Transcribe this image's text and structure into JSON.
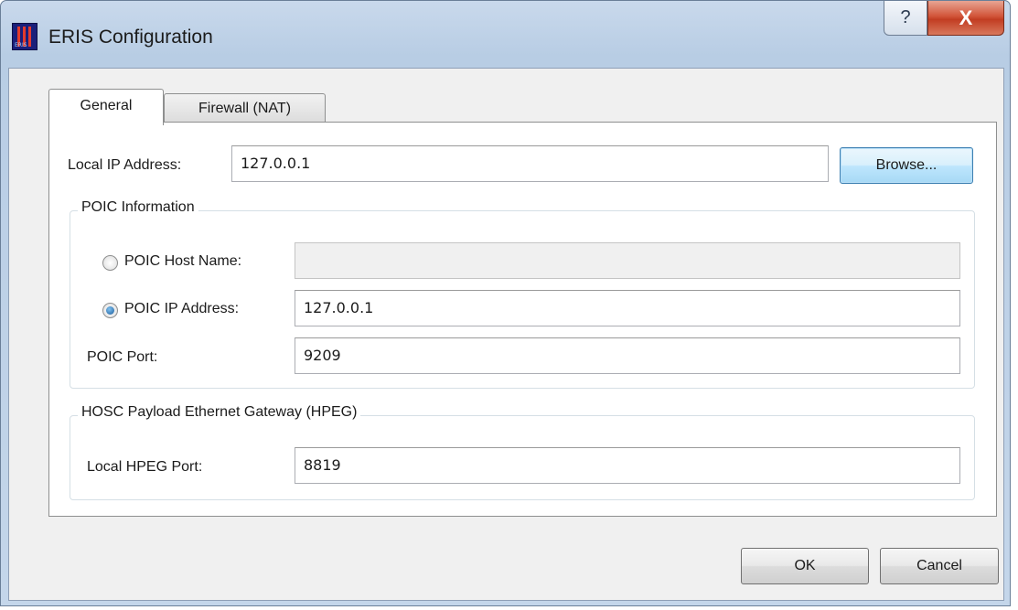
{
  "window": {
    "title": "ERIS Configuration",
    "help_glyph": "?",
    "close_glyph": "X",
    "icon_label": "ERIS"
  },
  "tabs": [
    {
      "label": "General",
      "selected": true
    },
    {
      "label": "Firewall (NAT)",
      "selected": false
    }
  ],
  "general": {
    "local_ip_label": "Local IP Address:",
    "local_ip_value": "127.0.0.1",
    "browse_label": "Browse...",
    "poic_group": {
      "title": "POIC Information",
      "host_name_label": "POIC Host Name:",
      "host_name_value": "",
      "host_name_selected": false,
      "ip_label": "POIC IP Address:",
      "ip_value": "127.0.0.1",
      "ip_selected": true,
      "port_label": "POIC Port:",
      "port_value": "9209"
    },
    "hpeg_group": {
      "title": "HOSC Payload Ethernet Gateway (HPEG)",
      "port_label": "Local HPEG Port:",
      "port_value": "8819"
    }
  },
  "footer": {
    "ok_label": "OK",
    "cancel_label": "Cancel"
  }
}
